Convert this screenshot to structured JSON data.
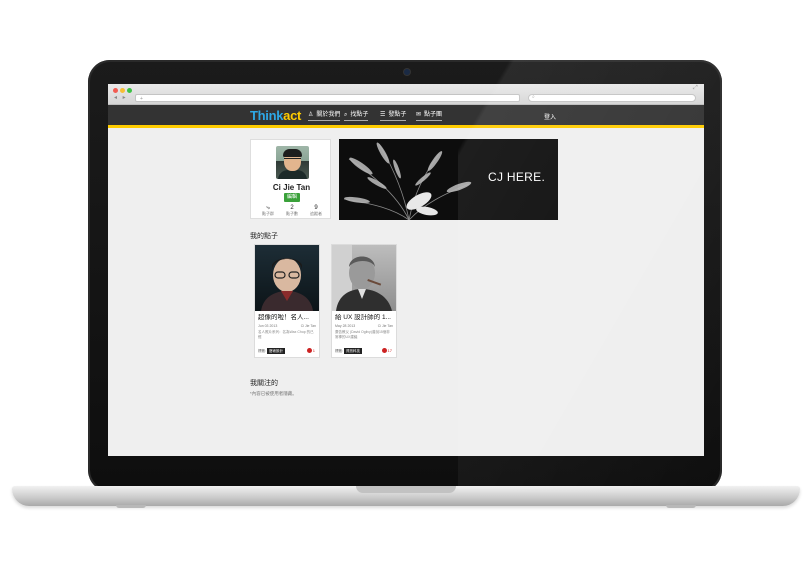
{
  "browser": {
    "nav_arrows": "◂ ▸",
    "url_value": "+",
    "search_glyph": "⌕",
    "resize_glyph": "⤢"
  },
  "site": {
    "logo_part1": "Think",
    "logo_part2": "act",
    "nav": [
      {
        "icon": "♙",
        "label": "關於我們"
      },
      {
        "icon": "⌕",
        "label": "找點子"
      },
      {
        "icon": "☰",
        "label": "發點子"
      },
      {
        "icon": "✉",
        "label": "點子團"
      }
    ],
    "login": "登入"
  },
  "profile": {
    "name": "Ci Jie Tan",
    "edit_label": "編輯",
    "stats": [
      {
        "value": "⤷",
        "label": "點子群"
      },
      {
        "value": "2",
        "label": "點子數"
      },
      {
        "value": "9",
        "label": "追蹤者"
      }
    ]
  },
  "cover": {
    "title": "CJ HERE."
  },
  "my_ideas": {
    "heading": "我的點子",
    "cards": [
      {
        "title": "超像的啦！名人...",
        "date": "Jun 03 2013",
        "author": "Ci Jie Tan",
        "desc": "名人照片系列：名為Wax Chop 的已經",
        "category_label": "標籤:",
        "tag": "藝術設計",
        "likes": "1"
      },
      {
        "title": "給 UX 設計師的 1...",
        "date": "May 28 2013",
        "author": "Ci Jie Tan",
        "desc": "廣告教父 (David Ogilvy)曾說15個非常棒的UX建議",
        "category_label": "標籤:",
        "tag": "資訊科技",
        "likes": "17"
      }
    ]
  },
  "following": {
    "heading": "我關注的",
    "note": "*內容已被使用者隱藏。"
  },
  "colors": {
    "accent_yellow": "#ffcc00",
    "logo_blue": "#2ea8e6",
    "edit_green": "#3aa13a",
    "nav_bg": "#333333"
  }
}
